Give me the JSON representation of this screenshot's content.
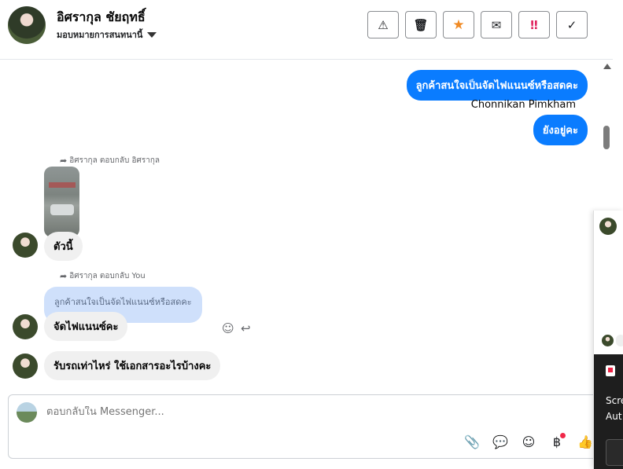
{
  "header": {
    "contact_name": "อิศรากุล ชัยฤทธิ์",
    "assign_label": "มอบหมายการสนทนานี้",
    "actions": [
      {
        "name": "spam",
        "glyph": "⚠"
      },
      {
        "name": "delete",
        "glyph": "🗑"
      },
      {
        "name": "star",
        "glyph": "★"
      },
      {
        "name": "mark-unread",
        "glyph": "✉"
      },
      {
        "name": "follow-up",
        "glyph": "‼"
      },
      {
        "name": "done",
        "glyph": "✓"
      }
    ]
  },
  "messages": {
    "outgoing_1": "ลูกค้าสนใจเป็นจัดไฟแนนซ์หรือสดคะ",
    "sender_name": "Chonnikan Pimkham",
    "outgoing_2": "ยังอยู่คะ",
    "reply_label_1": "อิศรากุล ตอบกลับ อิศรากุล",
    "incoming_image_caption": "ตัวนี้",
    "reply_label_2": "อิศรากุล ตอบกลับ You",
    "quoted_text": "ลูกค้าสนใจเป็นจัดไฟแนนซ์หรือสดคะ",
    "incoming_reply": "จัดไฟแนนซ์คะ",
    "incoming_last": "รับรถเท่าไหร่ ใช้เอกสารอะไรบ้างคะ"
  },
  "composer": {
    "placeholder": "ตอบกลับใน Messenger...",
    "tools": [
      {
        "name": "attach",
        "glyph": "📎"
      },
      {
        "name": "saved-replies",
        "glyph": "💬"
      },
      {
        "name": "emoji",
        "glyph": "☺"
      },
      {
        "name": "payment",
        "glyph": "฿"
      },
      {
        "name": "like",
        "glyph": "👍"
      }
    ]
  },
  "side_panel": {
    "text_1": "Scre",
    "text_2": "Aut"
  },
  "colors": {
    "outgoing_bubble": "#0a7cff",
    "incoming_bubble": "#f0f0f0",
    "quote_bubble": "#cfe0fb",
    "star": "#f08a24",
    "urgent": "#e0245e"
  }
}
